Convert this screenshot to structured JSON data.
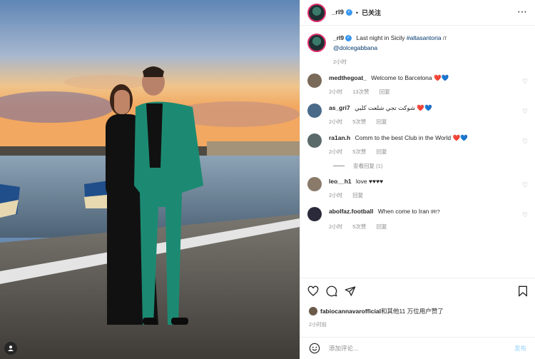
{
  "post": {
    "username": "_rl9",
    "follow_label": "已关注",
    "caption": {
      "text": "Last night in Sicily",
      "hashtag": "#altasantoria",
      "flag": "IT",
      "mention": "@dolcegabbana",
      "time": "2小时"
    }
  },
  "comments": [
    {
      "user": "medthegoat_",
      "text": "Welcome to Barcelona",
      "emoji": "❤️💙",
      "time": "2小时",
      "likes": "13次赞",
      "reply": "回复",
      "avatar_color": "#7a6a5a"
    },
    {
      "user": "as_gri7",
      "text": "شوكت تجي شلعت كلبي",
      "emoji": "❤️💙",
      "time": "2小时",
      "likes": "5次赞",
      "reply": "回复",
      "avatar_color": "#4a6a8a"
    },
    {
      "user": "ra1an.h",
      "text": "Comm to the best Club in the World",
      "emoji": "❤️💙",
      "time": "2小时",
      "likes": "5次赞",
      "reply": "回复",
      "avatar_color": "#5a6a6a"
    },
    {
      "user": "leo__h1",
      "text": "love",
      "emoji": "♥♥♥♥",
      "time": "2小时",
      "likes": "",
      "reply": "回复",
      "avatar_color": "#8a7a6a"
    },
    {
      "user": "abolfaz.football",
      "text": "When come to Iran",
      "emoji": "IR!?",
      "time": "2小时",
      "likes": "5次赞",
      "reply": "回复",
      "avatar_color": "#2a2a3a"
    }
  ],
  "view_replies_label": "查看回复 (1)",
  "likes_line": {
    "user": "fabiocannavarofficial",
    "rest": "和其他11 万位用户赞了"
  },
  "time_ago": "2小时前",
  "add_comment": {
    "placeholder": "添加评论...",
    "post_label": "发布"
  },
  "icons": {
    "more": "more-icon",
    "like": "heart-icon",
    "comment": "comment-icon",
    "share": "share-icon",
    "save": "bookmark-icon",
    "emoji": "emoji-icon",
    "tag": "user-tag-icon"
  },
  "colors": {
    "verified": "#3897f0",
    "link": "#00376b",
    "muted": "#8e8e8e",
    "post_disabled": "#b2dffc"
  }
}
